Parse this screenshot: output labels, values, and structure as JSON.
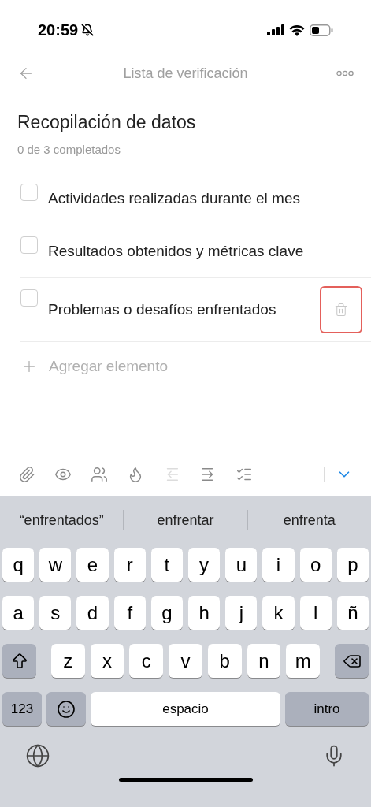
{
  "status_bar": {
    "time": "20:59"
  },
  "nav": {
    "title": "Lista de verificación"
  },
  "checklist": {
    "title": "Recopilación de datos",
    "progress": "0 de 3 completados",
    "items": [
      {
        "text": "Actividades realizadas durante el mes",
        "checked": false,
        "editing": false
      },
      {
        "text": "Resultados obtenidos y métricas clave",
        "checked": false,
        "editing": false
      },
      {
        "text": "Problemas o desafíos enfrentados",
        "checked": false,
        "editing": true
      }
    ],
    "add_label": "Agregar elemento"
  },
  "toolbar": [
    {
      "kind": "attach",
      "disabled": false
    },
    {
      "kind": "watch",
      "disabled": false
    },
    {
      "kind": "members",
      "disabled": false
    },
    {
      "kind": "priority",
      "disabled": false
    },
    {
      "kind": "outdent",
      "disabled": true
    },
    {
      "kind": "indent",
      "disabled": false
    },
    {
      "kind": "convert",
      "disabled": false
    }
  ],
  "keyboard": {
    "suggestions": [
      "“enfrentados”",
      "enfrentar",
      "enfrenta"
    ],
    "rows": [
      [
        {
          "kind": "letter",
          "label": "q"
        },
        {
          "kind": "letter",
          "label": "w"
        },
        {
          "kind": "letter",
          "label": "e"
        },
        {
          "kind": "letter",
          "label": "r"
        },
        {
          "kind": "letter",
          "label": "t"
        },
        {
          "kind": "letter",
          "label": "y"
        },
        {
          "kind": "letter",
          "label": "u"
        },
        {
          "kind": "letter",
          "label": "i"
        },
        {
          "kind": "letter",
          "label": "o"
        },
        {
          "kind": "letter",
          "label": "p"
        }
      ],
      [
        {
          "kind": "letter",
          "label": "a"
        },
        {
          "kind": "letter",
          "label": "s"
        },
        {
          "kind": "letter",
          "label": "d"
        },
        {
          "kind": "letter",
          "label": "f"
        },
        {
          "kind": "letter",
          "label": "g"
        },
        {
          "kind": "letter",
          "label": "h"
        },
        {
          "kind": "letter",
          "label": "j"
        },
        {
          "kind": "letter",
          "label": "k"
        },
        {
          "kind": "letter",
          "label": "l"
        },
        {
          "kind": "letter",
          "label": "ñ"
        }
      ],
      [
        {
          "kind": "shift"
        },
        {
          "kind": "letter",
          "label": "z"
        },
        {
          "kind": "letter",
          "label": "x"
        },
        {
          "kind": "letter",
          "label": "c"
        },
        {
          "kind": "letter",
          "label": "v"
        },
        {
          "kind": "letter",
          "label": "b"
        },
        {
          "kind": "letter",
          "label": "n"
        },
        {
          "kind": "letter",
          "label": "m"
        },
        {
          "kind": "backspace"
        }
      ]
    ],
    "bottom_row": [
      {
        "kind": "mode",
        "label": "123"
      },
      {
        "kind": "emoji"
      },
      {
        "kind": "space",
        "label": "espacio"
      },
      {
        "kind": "return",
        "label": "intro"
      }
    ]
  }
}
